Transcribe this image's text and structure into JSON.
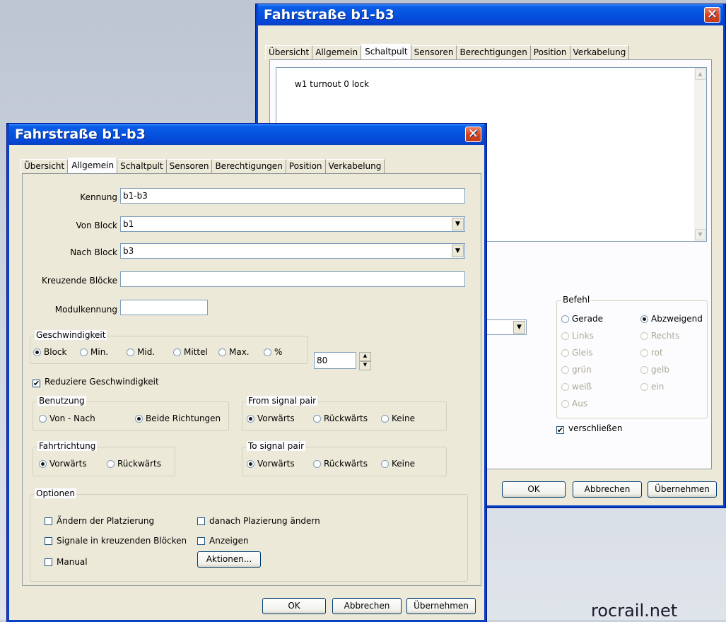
{
  "back_window": {
    "title": "Fahrstraße b1-b3",
    "close_glyph": "✕",
    "tabs": [
      "Übersicht",
      "Allgemein",
      "Schaltpult",
      "Sensoren",
      "Berechtigungen",
      "Position",
      "Verkabelung"
    ],
    "active_tab": "Schaltpult",
    "command_text": "w1 turnout 0 lock",
    "befehl": {
      "title": "Befehl",
      "options": [
        {
          "label": "Gerade",
          "checked": false,
          "enabled": true
        },
        {
          "label": "Abzweigend",
          "checked": true,
          "enabled": true
        },
        {
          "label": "Links",
          "checked": false,
          "enabled": false
        },
        {
          "label": "Rechts",
          "checked": false,
          "enabled": false
        },
        {
          "label": "Gleis",
          "checked": false,
          "enabled": false
        },
        {
          "label": "rot",
          "checked": false,
          "enabled": false
        },
        {
          "label": "grün",
          "checked": false,
          "enabled": false
        },
        {
          "label": "gelb",
          "checked": false,
          "enabled": false
        },
        {
          "label": "weiß",
          "checked": false,
          "enabled": false
        },
        {
          "label": "ein",
          "checked": false,
          "enabled": false
        },
        {
          "label": "Aus",
          "checked": false,
          "enabled": false
        }
      ]
    },
    "lock_label": "verschließen",
    "lock_checked": true,
    "buttons": {
      "ok": "OK",
      "cancel": "Abbrechen",
      "apply": "Übernehmen"
    }
  },
  "front_window": {
    "title": "Fahrstraße b1-b3",
    "close_glyph": "✕",
    "tabs": [
      "Übersicht",
      "Allgemein",
      "Schaltpult",
      "Sensoren",
      "Berechtigungen",
      "Position",
      "Verkabelung"
    ],
    "active_tab": "Allgemein",
    "fields": {
      "kennung_label": "Kennung",
      "kennung_value": "b1-b3",
      "von_block_label": "Von Block",
      "von_block_value": "b1",
      "nach_block_label": "Nach Block",
      "nach_block_value": "b3",
      "kreuzende_label": "Kreuzende Blöcke",
      "kreuzende_value": "",
      "modul_label": "Modulkennung",
      "modul_value": ""
    },
    "geschwindigkeit": {
      "title": "Geschwindigkeit",
      "options": [
        {
          "label": "Block",
          "checked": true
        },
        {
          "label": "Min.",
          "checked": false
        },
        {
          "label": "Mid.",
          "checked": false
        },
        {
          "label": "Mittel",
          "checked": false
        },
        {
          "label": "Max.",
          "checked": false
        },
        {
          "label": "%",
          "checked": false
        }
      ],
      "percent_value": "80"
    },
    "reduce_speed_label": "Reduziere Geschwindigkeit",
    "reduce_speed_checked": true,
    "benutzung": {
      "title": "Benutzung",
      "options": [
        {
          "label": "Von - Nach",
          "checked": false
        },
        {
          "label": "Beide Richtungen",
          "checked": true
        }
      ]
    },
    "from_signal_pair": {
      "title": "From signal pair",
      "options": [
        {
          "label": "Vorwärts",
          "checked": true
        },
        {
          "label": "Rückwärts",
          "checked": false
        },
        {
          "label": "Keine",
          "checked": false
        }
      ]
    },
    "fahrtrichtung": {
      "title": "Fahrtrichtung",
      "options": [
        {
          "label": "Vorwärts",
          "checked": true
        },
        {
          "label": "Rückwärts",
          "checked": false
        }
      ]
    },
    "to_signal_pair": {
      "title": "To signal pair",
      "options": [
        {
          "label": "Vorwärts",
          "checked": true
        },
        {
          "label": "Rückwärts",
          "checked": false
        },
        {
          "label": "Keine",
          "checked": false
        }
      ]
    },
    "optionen": {
      "title": "Optionen",
      "checks": [
        {
          "label": "Ändern der Platzierung",
          "checked": false
        },
        {
          "label": "danach Plazierung ändern",
          "checked": false
        },
        {
          "label": "Signale in kreuzenden Blöcken",
          "checked": false
        },
        {
          "label": "Anzeigen",
          "checked": false
        },
        {
          "label": "Manual",
          "checked": false
        }
      ],
      "actions_button": "Aktionen..."
    },
    "buttons": {
      "ok": "OK",
      "cancel": "Abbrechen",
      "apply": "Übernehmen"
    }
  },
  "watermark": "rocrail.net",
  "icons": {
    "dropdown": "▼",
    "spin_up": "▲",
    "spin_down": "▼",
    "scroll_up": "▲",
    "scroll_down": "▼",
    "check": "✔"
  }
}
